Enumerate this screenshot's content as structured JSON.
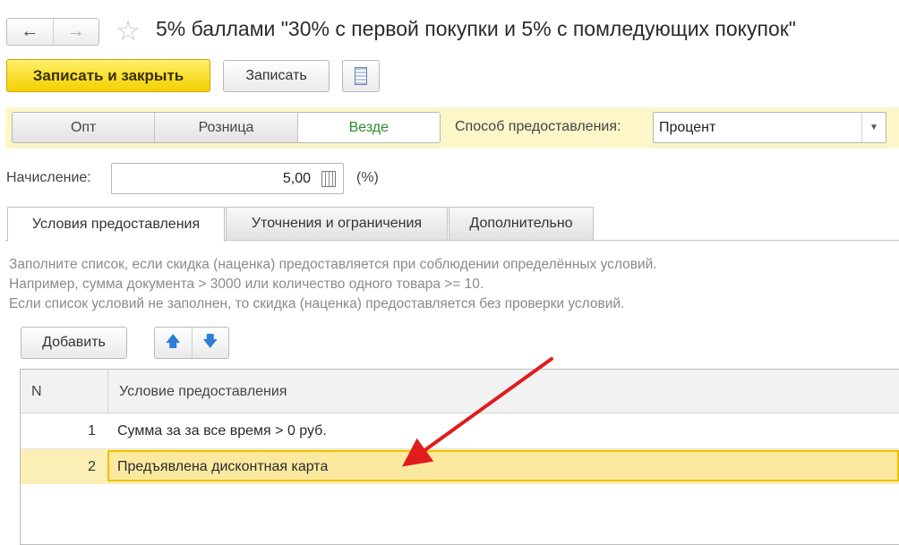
{
  "window": {
    "title": "5% баллами \"30% с первой покупки и 5% с помледующих покупок\""
  },
  "nav": {
    "back_icon": "←",
    "forward_icon": "→",
    "star_icon": "☆"
  },
  "toolbar": {
    "save_close_label": "Записать и закрыть",
    "save_label": "Записать"
  },
  "segments": {
    "items": [
      "Опт",
      "Розница",
      "Везде"
    ],
    "active": "Везде"
  },
  "method": {
    "label": "Способ предоставления:",
    "value": "Процент",
    "dropdown_icon": "▼"
  },
  "accrual": {
    "label": "Начисление:",
    "value": "5,00",
    "unit": "(%)"
  },
  "tabs": [
    "Условия предоставления",
    "Уточнения и ограничения",
    "Дополнительно"
  ],
  "hint": [
    "Заполните список, если скидка (наценка) предоставляется при соблюдении определённых условий.",
    "Например, сумма документа > 3000 или количество одного товара >= 10.",
    "Если список условий не заполнен, то скидка (наценка) предоставляется без проверки условий."
  ],
  "list_toolbar": {
    "add_label": "Добавить",
    "up_icon": "🡅",
    "down_icon": "🡇"
  },
  "table": {
    "columns": [
      "N",
      "Условие предоставления"
    ],
    "rows": [
      {
        "n": "1",
        "condition": "Сумма за за все время  > 0 руб."
      },
      {
        "n": "2",
        "condition": "Предъявлена дисконтная карта"
      }
    ]
  },
  "colors": {
    "primary_button": "#f3d000",
    "selected_row": "#fbefb5",
    "active_segment_text": "#2e8a2e",
    "annotation_arrow": "#e01c1c"
  }
}
